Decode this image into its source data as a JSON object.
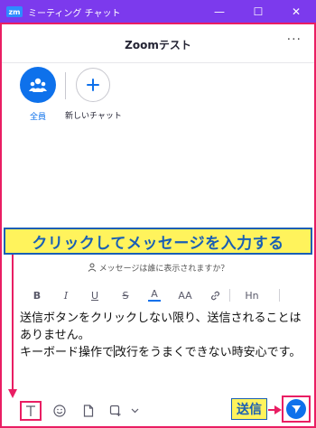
{
  "window": {
    "app_badge": "zm",
    "title": "ミーティング チャット",
    "minimize_glyph": "—",
    "maximize_glyph": "☐",
    "close_glyph": "✕"
  },
  "header": {
    "chat_title": "Zoomテスト",
    "more_glyph": "···"
  },
  "recipients": [
    {
      "label": "全員",
      "icon": "people-icon"
    },
    {
      "label": "新しいチャット",
      "icon": "plus-icon"
    }
  ],
  "annotations": {
    "banner": "クリックしてメッセージを入力する",
    "send_label": "送信"
  },
  "composer": {
    "visibility_text": "メッセージは誰に表示されますか？",
    "format": {
      "bold": "B",
      "italic": "I",
      "underline": "U",
      "strike": "S",
      "font_color": "A",
      "font_size": "AA",
      "heading": "Hn"
    },
    "message_part1": "送信ボタンをクリックしない限り、送信されることはありません。",
    "message_part2a": "キーボード操作で",
    "message_part2b": "改行をうまくできない時安心です。"
  },
  "colors": {
    "titlebar": "#7c3aed",
    "accent": "#0e71eb",
    "annotation_pink": "#e91e63",
    "annotation_yellow": "#fff35c",
    "annotation_blue": "#1a5fb4"
  }
}
